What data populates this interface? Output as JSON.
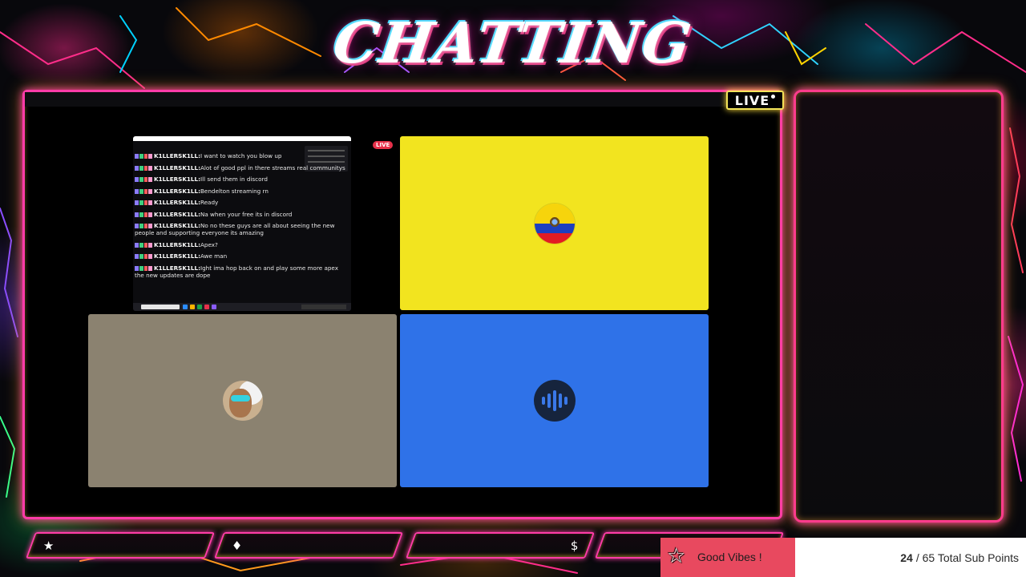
{
  "scene": {
    "title": "CHATTING",
    "live_badge": "LIVE"
  },
  "call": {
    "live_pill": "LIVE",
    "chat_panel": {
      "lines": [
        {
          "user": "K1LLERSK1LL:",
          "text": "I want to watch you blow up"
        },
        {
          "user": "K1LLERSK1LL:",
          "text": "Alot of good ppl in there streams real communitys"
        },
        {
          "user": "K1LLERSK1LL:",
          "text": "Ill send them in discord"
        },
        {
          "user": "K1LLERSK1LL:",
          "text": "Bendelton streaming rn"
        },
        {
          "user": "K1LLERSK1LL:",
          "text": "Ready"
        },
        {
          "user": "K1LLERSK1LL:",
          "text": "Na when your free its in discord"
        },
        {
          "user": "K1LLERSK1LL:",
          "text": "No no these guys are all about seeing the new people and supporting everyone its amazing"
        },
        {
          "user": "K1LLERSK1LL:",
          "text": "Apex?"
        },
        {
          "user": "K1LLERSK1LL:",
          "text": "Awe man"
        },
        {
          "user": "K1LLERSK1LL:",
          "text": "Ight ima hop back on and play some more apex the new updates are dope"
        }
      ]
    },
    "tiles": {
      "flag_icon": "ecuador-flag-avatar",
      "cam_icon": "webcam-avatar",
      "audio_icon": "audio-wave-avatar",
      "colors": {
        "flag_bg": "#f2e41f",
        "cam_bg": "#8b8270",
        "audio_bg": "#2f72e8"
      }
    }
  },
  "bottom_bars": [
    {
      "icon": "star-icon",
      "glyph": "★"
    },
    {
      "icon": "diamond-icon",
      "glyph": "♦"
    },
    {
      "icon": "dollar-icon",
      "glyph": "$"
    },
    {
      "icon": "blank",
      "glyph": ""
    }
  ],
  "sub_goal": {
    "label": "Good Vibes !",
    "current": "24",
    "total_text": "/ 65 Total Sub Points",
    "accent": "#e8495f"
  }
}
